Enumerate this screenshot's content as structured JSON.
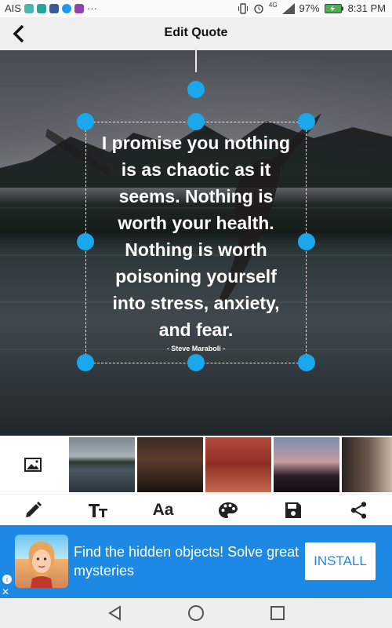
{
  "status_bar": {
    "carrier": "AIS",
    "network": "4G",
    "battery": "97%",
    "time": "8:31 PM",
    "more": "···"
  },
  "app_bar": {
    "title": "Edit Quote"
  },
  "quote": {
    "lines": [
      "I promise you nothing",
      "is as chaotic as it",
      "seems. Nothing is",
      "worth your health.",
      "Nothing is worth",
      "poisoning yourself",
      "into stress, anxiety,",
      "and fear."
    ],
    "author": "- Steve Maraboli -",
    "text_color": "#ffffff",
    "handle_color": "#1aa7ec"
  },
  "backgrounds": {
    "items": [
      "jumping-person-lake",
      "couple-silhouette",
      "running-track-legs",
      "person-on-hill-sunset",
      "old-man-portrait"
    ]
  },
  "toolbar": {
    "tools": [
      "edit",
      "text-size",
      "font",
      "color-palette",
      "save",
      "share"
    ],
    "font_glyph": "Aa"
  },
  "ad": {
    "text": "Find the hidden objects! Solve great mysteries",
    "install_label": "INSTALL",
    "info_glyph": "i",
    "close_glyph": "✕",
    "accent": "#1e88e5"
  }
}
